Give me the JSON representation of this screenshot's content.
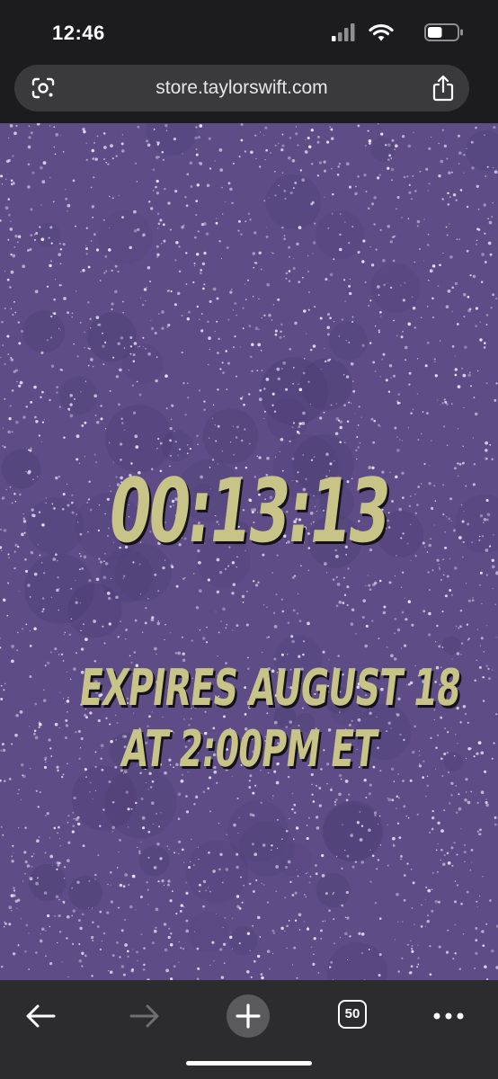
{
  "status_bar": {
    "time": "12:46",
    "icons": [
      "signal-icon",
      "wifi-icon",
      "battery-icon"
    ],
    "battery_level": 0.5
  },
  "browser": {
    "url": "store.taylorswift.com",
    "icons": [
      "lens-icon",
      "share-icon"
    ]
  },
  "page": {
    "countdown": "00:13:13",
    "expires_line_1": "EXPIRES AUGUST 18",
    "expires_line_2": "AT 2:00PM ET",
    "colors": {
      "background": "#5d4c86",
      "glitter": "#e6e1f5",
      "text": "#c8c487",
      "text_shadow": "#141216"
    }
  },
  "toolbar": {
    "tabs_count": "50",
    "icons": [
      "back-icon",
      "forward-icon",
      "new-tab-icon",
      "tabs-icon",
      "more-icon"
    ]
  }
}
